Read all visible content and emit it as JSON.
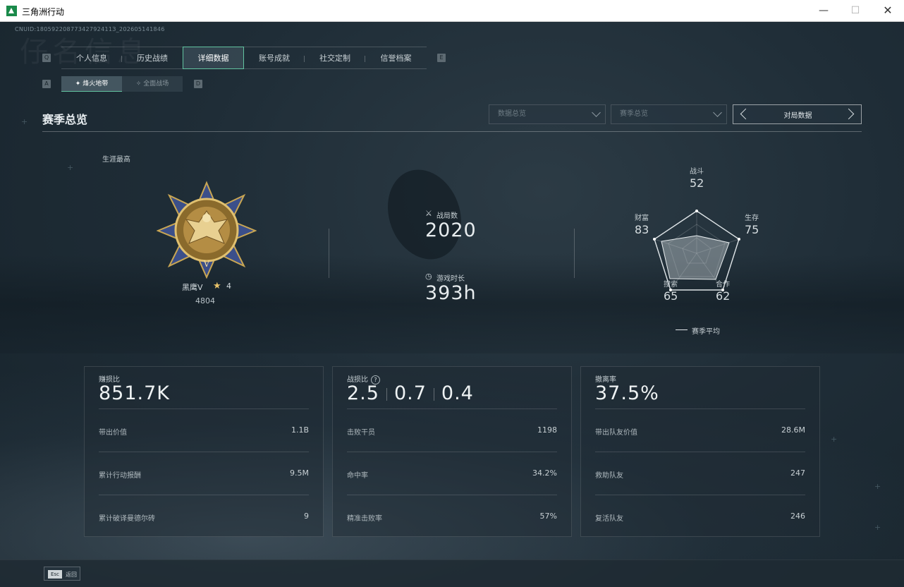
{
  "window": {
    "title": "三角洲行动",
    "minimize": "—",
    "maximize": "☐",
    "close": "✕"
  },
  "background_text": "仔名信息",
  "cnuid": "CNUID:18059220877342792411З_202605141846",
  "tabs": {
    "left_key": "Q",
    "right_key": "E",
    "items": [
      "个人信息",
      "历史战绩",
      "详细数据",
      "账号成就",
      "社交定制",
      "信誉档案"
    ],
    "active_index": 2
  },
  "subtabs": {
    "left_key": "A",
    "right_key": "D",
    "items": [
      "烽火地带",
      "全面战场"
    ],
    "active_index": 0
  },
  "section": {
    "title": "赛季总览"
  },
  "filters": {
    "data_filter": "数据总览",
    "season_filter": "赛季总览",
    "pager_label": "对局数据"
  },
  "career": {
    "label": "生涯最高",
    "rank_name": "黑鹰V",
    "rank_stars": "4",
    "rank_score": "4804"
  },
  "stats": {
    "matches_label": "战局数",
    "matches_value": "2020",
    "playtime_label": "游戏时长",
    "playtime_value": "393h"
  },
  "radar": {
    "axes": [
      {
        "label": "战斗",
        "value": "52"
      },
      {
        "label": "生存",
        "value": "75"
      },
      {
        "label": "合作",
        "value": "62"
      },
      {
        "label": "搜索",
        "value": "65"
      },
      {
        "label": "财富",
        "value": "83"
      }
    ],
    "legend": "赛季平均"
  },
  "panels": {
    "profit": {
      "label": "赚损比",
      "value": "851.7K",
      "rows": [
        {
          "k": "带出价值",
          "v": "1.1B"
        },
        {
          "k": "累计行动报酬",
          "v": "9.5M"
        },
        {
          "k": "累计破译曼德尔砖",
          "v": "9"
        }
      ]
    },
    "combat": {
      "label": "战损比",
      "help": "?",
      "values": [
        "2.5",
        "0.7",
        "0.4"
      ],
      "rows": [
        {
          "k": "击败干员",
          "v": "1198"
        },
        {
          "k": "命中率",
          "v": "34.2%"
        },
        {
          "k": "精准击败率",
          "v": "57%"
        }
      ]
    },
    "extract": {
      "label": "撤离率",
      "value": "37.5%",
      "rows": [
        {
          "k": "带出队友价值",
          "v": "28.6M"
        },
        {
          "k": "救助队友",
          "v": "247"
        },
        {
          "k": "复活队友",
          "v": "246"
        }
      ]
    }
  },
  "footer": {
    "esc_key": "Esc",
    "esc_label": "返回"
  }
}
